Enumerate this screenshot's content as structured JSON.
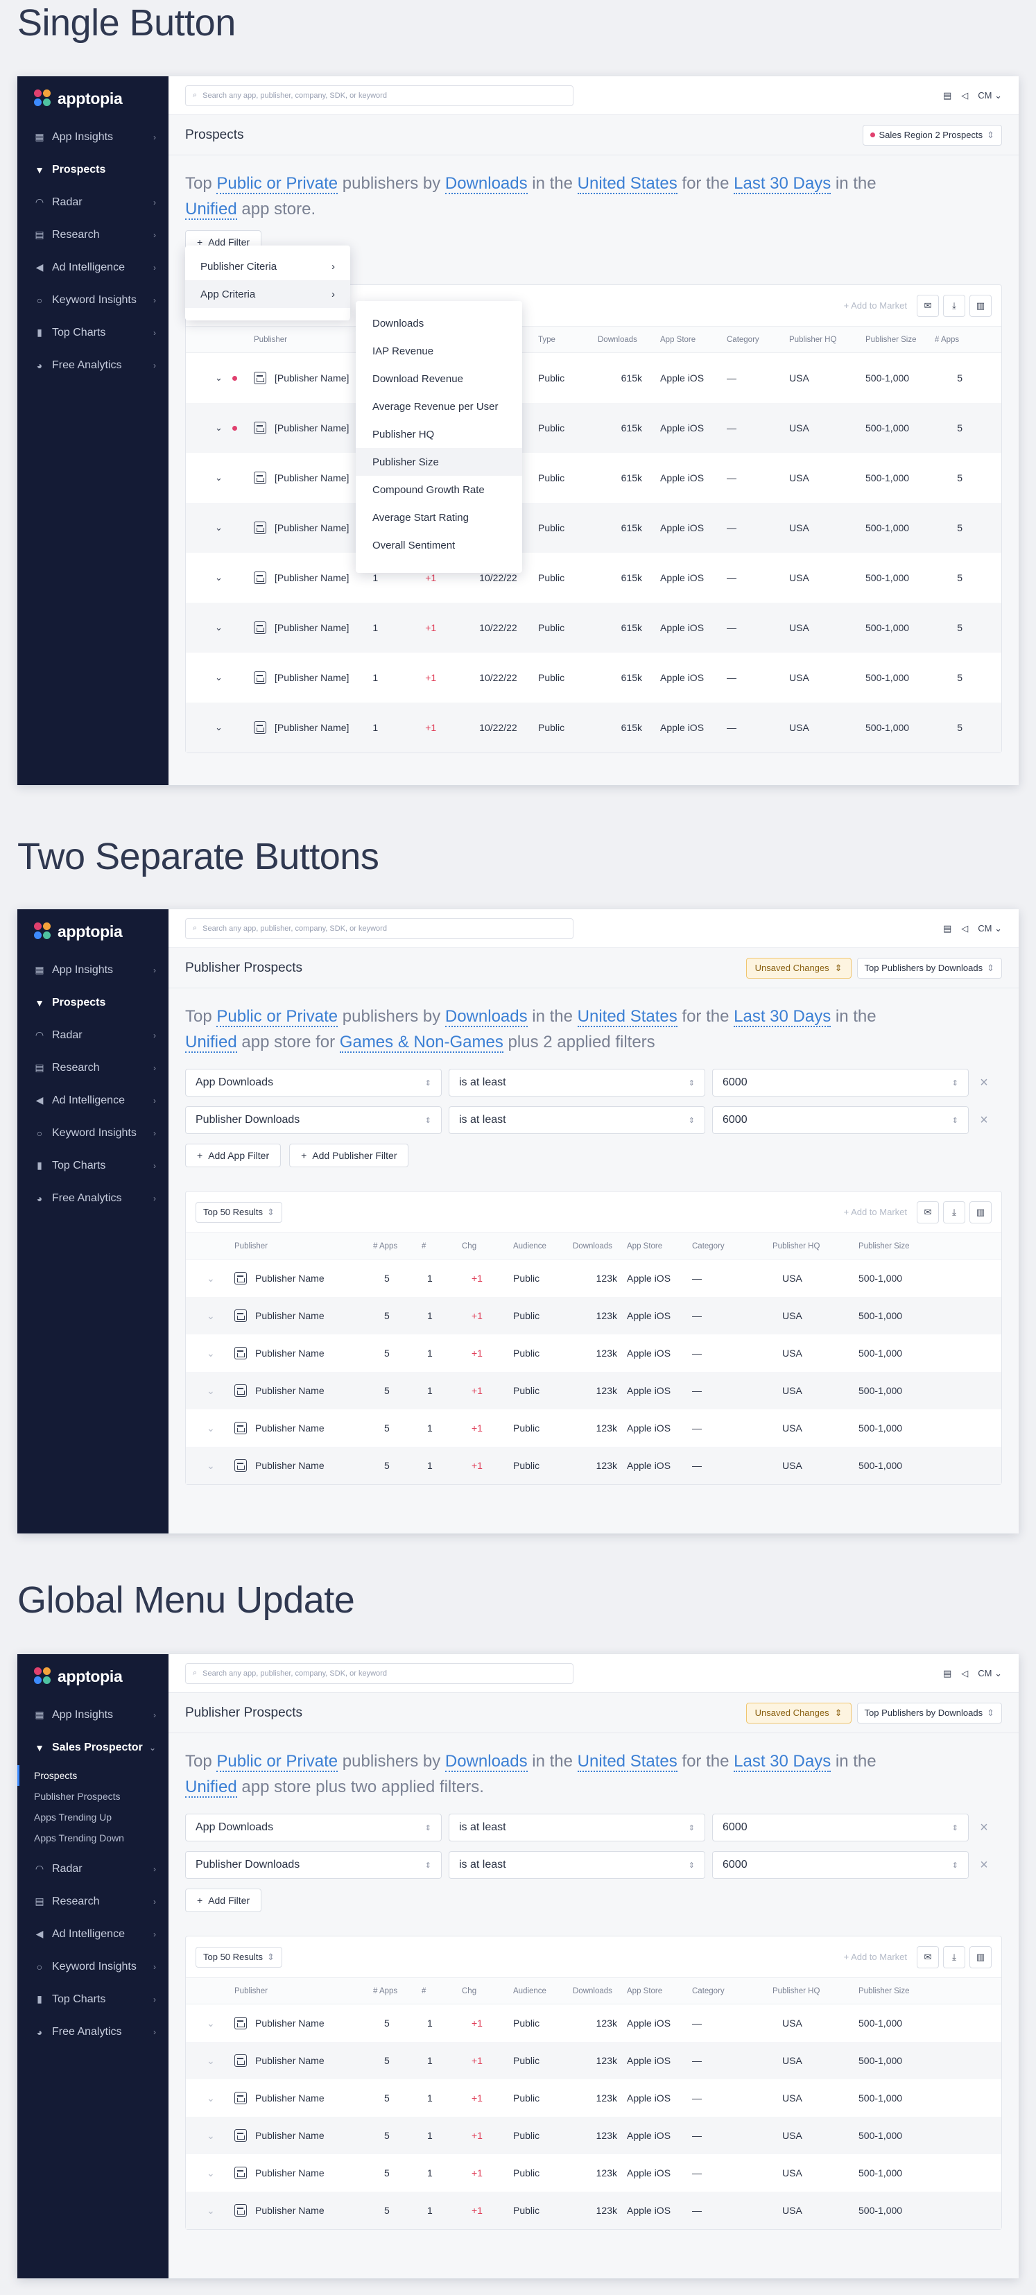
{
  "sections": {
    "single": "Single Button",
    "separate": "Two Separate Buttons",
    "global": "Global Menu Update"
  },
  "brand": {
    "name": "apptopia",
    "colors": [
      "#e0406e",
      "#f4a33b",
      "#3d8bfd",
      "#4fc3a1"
    ]
  },
  "search": {
    "placeholder": "Search any app, publisher, company, SDK, or keyword"
  },
  "user": {
    "initials": "CM"
  },
  "nav": {
    "app_insights": "App Insights",
    "prospects": "Prospects",
    "radar": "Radar",
    "research": "Research",
    "ad_intelligence": "Ad Intelligence",
    "keyword_insights": "Keyword Insights",
    "top_charts": "Top Charts",
    "free_analytics": "Free Analytics",
    "sales_prospector": "Sales Prospector",
    "sub_prospects": "Prospects",
    "sub_publisher_prospects": "Publisher Prospects",
    "sub_trending_up": "Apps Trending Up",
    "sub_trending_down": "Apps Trending Down"
  },
  "s1": {
    "title": "Prospects",
    "segment": "Sales Region 2 Prospects",
    "sentence": {
      "p1": "Top ",
      "h1": "Public or Private",
      "p2": " publishers by ",
      "h2": "Downloads",
      "p3": " in the ",
      "h3": "United States",
      "p4": " for the ",
      "h4": "Last 30 Days",
      "p5": " in the ",
      "h5": "Unified",
      "p6": " app store."
    },
    "add_filter": "Add Filter",
    "menu": {
      "publisher": "Publisher Citeria",
      "app": "App Criteria"
    },
    "submenu": [
      "Downloads",
      "IAP Revenue",
      "Download Revenue",
      "Average Revenue per User",
      "Publisher HQ",
      "Publisher Size",
      "Compound Growth Rate",
      "Average Start Rating",
      "Overall Sentiment"
    ],
    "add_market": "Add to Market",
    "columns": [
      "Publisher",
      "Type",
      "Downloads",
      "App Store",
      "Category",
      "Publisher HQ",
      "Publisher Size",
      "# Apps"
    ],
    "row": {
      "name": "[Publisher Name]",
      "n1": "1",
      "chg": "+1",
      "date": "10/22/22",
      "type": "Public",
      "downloads": "615k",
      "store": "Apple iOS",
      "category": "—",
      "hq": "USA",
      "size": "500-1,000",
      "apps": "5"
    }
  },
  "s2": {
    "title": "Publisher Prospects",
    "unsaved": "Unsaved Changes",
    "preset": "Top Publishers by Downloads",
    "sentence": {
      "p1": "Top ",
      "h1": "Public or Private",
      "p2": " publishers by ",
      "h2": "Downloads",
      "p3": " in the ",
      "h3": "United States",
      "p4": " for the ",
      "h4": "Last 30 Days",
      "p5": " in the ",
      "h5": "Unified",
      "p6": " app store for ",
      "h6": "Games & Non-Games",
      "p7": " plus 2 applied filters"
    },
    "filters": [
      {
        "field": "App Downloads",
        "op": "is at least",
        "value": "6000"
      },
      {
        "field": "Publisher Downloads",
        "op": "is at least",
        "value": "6000"
      }
    ],
    "add_app_filter": "Add App Filter",
    "add_publisher_filter": "Add Publisher Filter",
    "results": "Top 50 Results",
    "add_market": "Add to Market",
    "columns": [
      "Publisher",
      "# Apps",
      "#",
      "Chg",
      "Audience",
      "Downloads",
      "App Store",
      "Category",
      "Publisher HQ",
      "Publisher Size"
    ],
    "row": {
      "name": "Publisher Name",
      "apps": "5",
      "rank": "1",
      "chg": "+1",
      "audience": "Public",
      "downloads": "123k",
      "store": "Apple iOS",
      "category": "—",
      "hq": "USA",
      "size": "500-1,000"
    }
  },
  "s3": {
    "title": "Publisher Prospects",
    "unsaved": "Unsaved Changes",
    "preset": "Top Publishers by Downloads",
    "sentence": {
      "p1": "Top ",
      "h1": "Public or Private",
      "p2": " publishers by ",
      "h2": "Downloads",
      "p3": " in the ",
      "h3": "United States",
      "p4": " for the ",
      "h4": "Last 30 Days",
      "p5": " in the ",
      "h5": "Unified",
      "p6": " app store plus two applied filters."
    },
    "add_filter": "Add Filter"
  }
}
